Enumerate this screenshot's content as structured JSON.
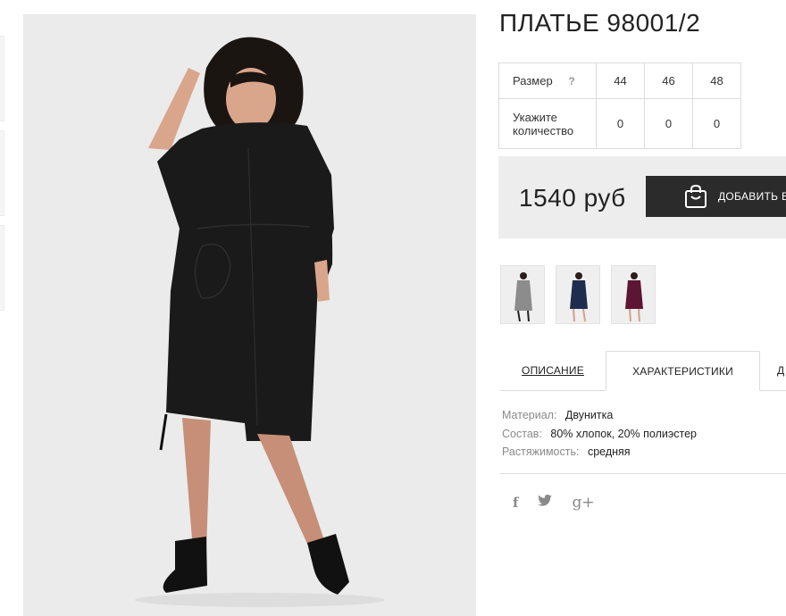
{
  "product": {
    "title": "ПЛАТЬЕ 98001/2",
    "price": "1540 руб",
    "add_to_cart_label": "ДОБАВИТЬ В КОРЗИНУ"
  },
  "size_table": {
    "size_label": "Размер",
    "help_icon": "?",
    "qty_label": "Укажите количество",
    "sizes": [
      "44",
      "46",
      "48"
    ],
    "quantities": [
      "0",
      "0",
      "0"
    ]
  },
  "swatches": [
    {
      "color_name": "grey",
      "color": "#8c8c8c"
    },
    {
      "color_name": "navy",
      "color": "#1e2c4f"
    },
    {
      "color_name": "burgundy",
      "color": "#5c1633"
    }
  ],
  "tabs": [
    "ОПИСАНИЕ",
    "ХАРАКТЕРИСТИКИ",
    "Д"
  ],
  "specs": [
    {
      "key": "Материал:",
      "value": "Двунитка"
    },
    {
      "key": "Состав:",
      "value": "80% хлопок, 20% полиэстер"
    },
    {
      "key": "Растяжимость:",
      "value": "средняя"
    }
  ],
  "social": {
    "facebook_glyph": "f",
    "gplus_glyph": "g+"
  },
  "colors": {
    "button_bg": "#2b2b2b",
    "price_box_bg": "#ededed",
    "dress": "#1a1a1a"
  }
}
